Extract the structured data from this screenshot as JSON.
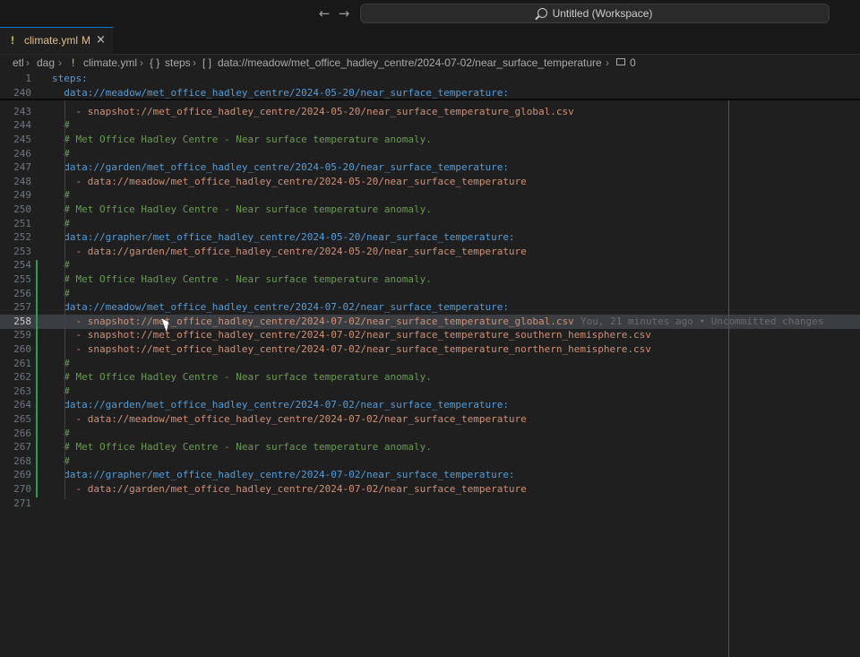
{
  "titlebar": {
    "back_glyph": "←",
    "forward_glyph": "→",
    "search_text": "Untitled (Workspace)"
  },
  "tab": {
    "icon": "!",
    "name": "climate.yml",
    "modified": "M",
    "close": "×"
  },
  "breadcrumbs": {
    "items": [
      "etl",
      "dag",
      "climate.yml",
      "steps",
      "data://meadow/met_office_hadley_centre/2024-07-02/near_surface_temperature",
      "0"
    ],
    "yaml_icon": "!",
    "object_icon": "{ }",
    "array_icon": "[ ]"
  },
  "colors": {
    "keyword": "#569cd6",
    "comment": "#6a9955",
    "string": "#ce9178",
    "git_added": "#2ea043"
  },
  "lines": [
    {
      "n": "1",
      "kind": "key",
      "text": "steps:"
    },
    {
      "n": "240",
      "kind": "key",
      "text": "  data://meadow/met_office_hadley_centre/2024-05-20/near_surface_temperature:"
    },
    {
      "n": "243",
      "kind": "str",
      "text": "    - snapshot://met_office_hadley_centre/2024-05-20/near_surface_temperature_global.csv"
    },
    {
      "n": "244",
      "kind": "com",
      "text": "  #"
    },
    {
      "n": "245",
      "kind": "com",
      "text": "  # Met Office Hadley Centre - Near surface temperature anomaly."
    },
    {
      "n": "246",
      "kind": "com",
      "text": "  #"
    },
    {
      "n": "247",
      "kind": "key",
      "text": "  data://garden/met_office_hadley_centre/2024-05-20/near_surface_temperature:"
    },
    {
      "n": "248",
      "kind": "str",
      "text": "    - data://meadow/met_office_hadley_centre/2024-05-20/near_surface_temperature"
    },
    {
      "n": "249",
      "kind": "com",
      "text": "  #"
    },
    {
      "n": "250",
      "kind": "com",
      "text": "  # Met Office Hadley Centre - Near surface temperature anomaly."
    },
    {
      "n": "251",
      "kind": "com",
      "text": "  #"
    },
    {
      "n": "252",
      "kind": "key",
      "text": "  data://grapher/met_office_hadley_centre/2024-05-20/near_surface_temperature:"
    },
    {
      "n": "253",
      "kind": "str",
      "text": "    - data://garden/met_office_hadley_centre/2024-05-20/near_surface_temperature"
    },
    {
      "n": "254",
      "kind": "com",
      "text": "  #"
    },
    {
      "n": "255",
      "kind": "com",
      "text": "  # Met Office Hadley Centre - Near surface temperature anomaly."
    },
    {
      "n": "256",
      "kind": "com",
      "text": "  #"
    },
    {
      "n": "257",
      "kind": "key",
      "text": "  data://meadow/met_office_hadley_centre/2024-07-02/near_surface_temperature:"
    },
    {
      "n": "258",
      "kind": "str",
      "text": "    - snapshot://met_office_hadley_centre/2024-07-02/near_surface_temperature_global.csv"
    },
    {
      "n": "259",
      "kind": "str",
      "text": "    - snapshot://met_office_hadley_centre/2024-07-02/near_surface_temperature_southern_hemisphere.csv"
    },
    {
      "n": "260",
      "kind": "str",
      "text": "    - snapshot://met_office_hadley_centre/2024-07-02/near_surface_temperature_northern_hemisphere.csv"
    },
    {
      "n": "261",
      "kind": "com",
      "text": "  #"
    },
    {
      "n": "262",
      "kind": "com",
      "text": "  # Met Office Hadley Centre - Near surface temperature anomaly."
    },
    {
      "n": "263",
      "kind": "com",
      "text": "  #"
    },
    {
      "n": "264",
      "kind": "key",
      "text": "  data://garden/met_office_hadley_centre/2024-07-02/near_surface_temperature:"
    },
    {
      "n": "265",
      "kind": "str",
      "text": "    - data://meadow/met_office_hadley_centre/2024-07-02/near_surface_temperature"
    },
    {
      "n": "266",
      "kind": "com",
      "text": "  #"
    },
    {
      "n": "267",
      "kind": "com",
      "text": "  # Met Office Hadley Centre - Near surface temperature anomaly."
    },
    {
      "n": "268",
      "kind": "com",
      "text": "  #"
    },
    {
      "n": "269",
      "kind": "key",
      "text": "  data://grapher/met_office_hadley_centre/2024-07-02/near_surface_temperature:"
    },
    {
      "n": "270",
      "kind": "str",
      "text": "    - data://garden/met_office_hadley_centre/2024-07-02/near_surface_temperature"
    },
    {
      "n": "271",
      "kind": "blank",
      "text": ""
    }
  ],
  "active_line": "258",
  "blame": "You, 21 minutes ago • Uncommitted changes"
}
